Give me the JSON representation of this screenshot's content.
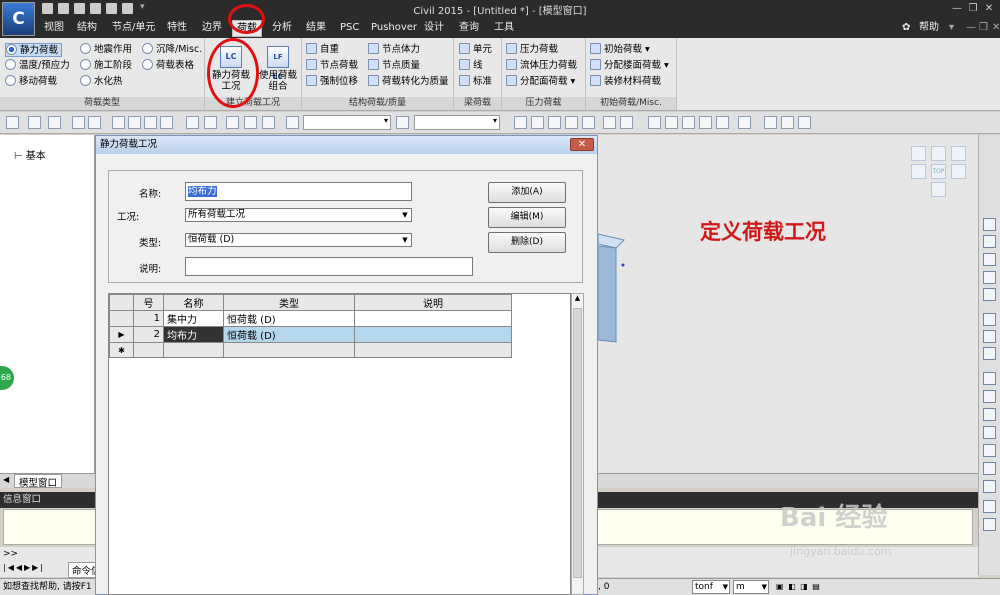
{
  "window": {
    "title": "Civil 2015 - [Untitled *] - [模型窗口]"
  },
  "app": {
    "logo": "C"
  },
  "menu": {
    "items": [
      "视图",
      "结构",
      "节点/单元",
      "特性",
      "边界",
      "荷载",
      "分析",
      "结果",
      "PSC",
      "Pushover",
      "设计",
      "查询",
      "工具"
    ],
    "active": "荷载",
    "help": "帮助"
  },
  "ribbon": {
    "load_type": {
      "label": "荷载类型",
      "items": [
        "静力荷载",
        "温度/预应力",
        "移动荷载",
        "地震作用",
        "施工阶段",
        "水化热",
        "沉降/Misc.",
        "荷载表格"
      ],
      "selected": "静力荷载"
    },
    "create_case": {
      "label": "建立荷载工况",
      "static_case": "静力荷载\n工况",
      "static_case_icon": "LC",
      "combo": "使用荷载\n组合",
      "combo_icon": "LF LC"
    },
    "structural": {
      "label": "结构荷载/质量",
      "items": [
        "自重",
        "节点荷载",
        "强制位移",
        "节点体力",
        "节点质量",
        "荷载转化为质量"
      ]
    },
    "beam": {
      "label": "梁荷载",
      "items": [
        "单元",
        "线",
        "标准"
      ]
    },
    "pressure": {
      "label": "压力荷载",
      "items": [
        "压力荷载",
        "流体压力荷载",
        "分配面荷载"
      ]
    },
    "initial": {
      "label": "初始荷载/Misc.",
      "items": [
        "初始荷载",
        "分配楼面荷载",
        "装修材料荷载"
      ]
    }
  },
  "tree": {
    "root": "基本"
  },
  "dialog": {
    "title": "静力荷载工况",
    "close": "✕",
    "name_label": "名称:",
    "name_value": "均布力",
    "case_label": "工况:",
    "case_value": "所有荷载工况",
    "type_label": "类型:",
    "type_value": "恒荷载  (D)",
    "desc_label": "说明:",
    "desc_value": "",
    "add_button": "添加(A)",
    "edit_button": "编辑(M)",
    "delete_button": "删除(D)",
    "table": {
      "headers": [
        "号",
        "名称",
        "类型",
        "说明"
      ],
      "rows": [
        {
          "marker": "",
          "no": "1",
          "name": "集中力",
          "type": "恒荷载 (D)",
          "desc": ""
        },
        {
          "marker": "▶",
          "no": "2",
          "name": "均布力",
          "type": "恒荷载 (D)",
          "desc": ""
        }
      ],
      "new_row_marker": "✱"
    }
  },
  "annotation": "定义荷载工况",
  "navcube": {
    "top_label": "TOP"
  },
  "bottom_tab": "模型窗口",
  "message_window": {
    "title": "信息窗口"
  },
  "command": {
    "tab": "命令信",
    "prompt": ">>"
  },
  "status": {
    "hint": "如想查找帮助, 请按F1",
    "coord": ", 0",
    "force_unit": "tonf",
    "length_unit": "m",
    "badge": "68"
  },
  "watermark": {
    "brand": "Bai 经验",
    "url": "jingyan.baidu.com"
  },
  "colors": {
    "accent_red": "#e01010",
    "selected_row": "#b5d7ee",
    "title_dark": "#2b2b2b"
  }
}
